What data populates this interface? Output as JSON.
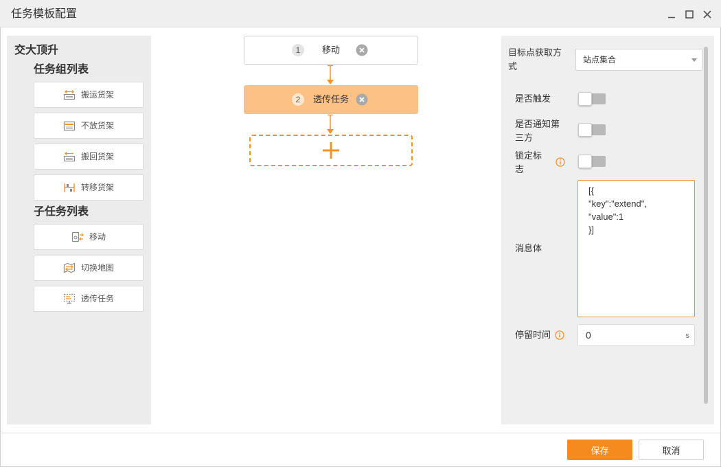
{
  "window": {
    "title": "任务模板配置",
    "controls": [
      "minimize-icon",
      "maximize-icon",
      "close-icon"
    ]
  },
  "left_panel": {
    "project_name": "交大顶升",
    "group_list_title": "任务组列表",
    "groups": [
      {
        "label": "搬运货架",
        "icon": "carry-shelf-icon"
      },
      {
        "label": "不放货架",
        "icon": "hold-shelf-icon"
      },
      {
        "label": "搬回货架",
        "icon": "return-shelf-icon"
      },
      {
        "label": "转移货架",
        "icon": "transfer-shelf-icon"
      }
    ],
    "subtask_list_title": "子任务列表",
    "subtasks": [
      {
        "label": "移动",
        "icon": "move-icon"
      },
      {
        "label": "切换地图",
        "icon": "switch-map-icon"
      },
      {
        "label": "透传任务",
        "icon": "passthrough-icon"
      }
    ]
  },
  "flow": {
    "nodes": [
      {
        "index": "1",
        "label": "移动",
        "selected": false
      },
      {
        "index": "2",
        "label": "透传任务",
        "selected": true
      }
    ],
    "add_node_icon": "plus-icon",
    "remove_node_icon": "remove-node-icon"
  },
  "properties": {
    "target_method": {
      "label": "目标点获取方式",
      "value": "站点集合"
    },
    "trigger": {
      "label": "是否触发",
      "on": false
    },
    "notify_third_party": {
      "label": "是否通知第三方",
      "on": false
    },
    "lock_flag": {
      "label": "锁定标志",
      "on": false,
      "info_icon": "info-icon"
    },
    "message_body": {
      "label": "消息体",
      "value": "[{\n\"key\":\"extend\",\n\"value\":1\n}]"
    },
    "dwell_time": {
      "label": "停留时间",
      "value": "0",
      "unit": "s",
      "info_icon": "info-icon"
    }
  },
  "footer": {
    "save_label": "保存",
    "cancel_label": "取消"
  },
  "colors": {
    "accent": "#f39321",
    "selected_node": "#fcc185",
    "save_button": "#f58a1f",
    "panel_bg": "#ececec"
  }
}
